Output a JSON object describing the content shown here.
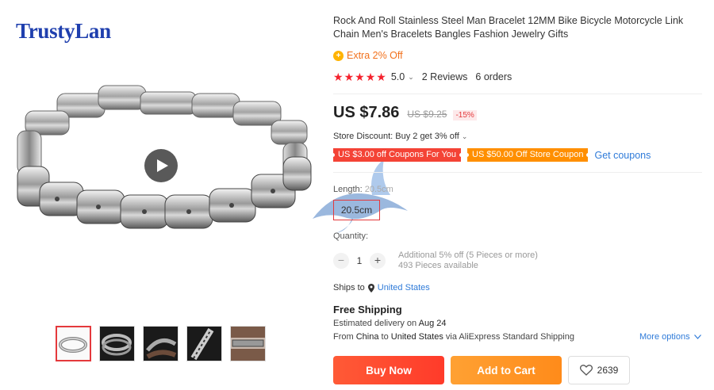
{
  "brand": {
    "name": "TrustyLan"
  },
  "product": {
    "title": "Rock And Roll Stainless Steel Man Bracelet 12MM Bike Bicycle Motorcycle Link Chain Men's Bracelets Bangles Fashion Jewelry Gifts",
    "extra_off": "Extra 2% Off",
    "rating": "5.0",
    "rating_stars": 5,
    "reviews": "2 Reviews",
    "orders": "6 orders",
    "price": "US $7.86",
    "old_price": "US $9.25",
    "discount": "-15%",
    "store_discount": "Store Discount: Buy 2 get 3% off",
    "coupons": [
      {
        "label": "US $3.00 off Coupons For You",
        "color": "#f44336"
      },
      {
        "label": "US $50.00 Off Store Coupon",
        "color": "#ff8f00"
      }
    ],
    "get_coupons": "Get coupons",
    "length_label": "Length:",
    "length_selected": "20.5cm",
    "length_option": "20.5cm",
    "quantity_label": "Quantity:",
    "quantity_value": "1",
    "quantity_note_1": "Additional 5% off (5 Pieces or more)",
    "quantity_note_2": "493 Pieces available",
    "ships_to_label": "Ships to",
    "ships_to_country": "United States",
    "free_shipping": "Free Shipping",
    "delivery_prefix": "Estimated delivery on",
    "delivery_date": "Aug 24",
    "route_from_label": "From",
    "route_from": "China",
    "route_to_label": "to",
    "route_to": "United States",
    "route_via": "via AliExpress Standard Shipping",
    "more_options": "More options",
    "buy_now": "Buy Now",
    "add_to_cart": "Add to Cart",
    "wishlist_count": "2639"
  },
  "colors": {
    "accent_red": "#e4393c",
    "link_blue": "#2f7bd9",
    "buy_now": "#ff4a30",
    "add_to_cart": "#ff951f",
    "brand_blue": "#1f3fae"
  },
  "gallery": {
    "thumbnails": [
      "thumb-bracelet-white",
      "thumb-bracelet-dark",
      "thumb-bracelet-wrist",
      "thumb-bracelet-detail",
      "thumb-bracelet-worn"
    ]
  }
}
